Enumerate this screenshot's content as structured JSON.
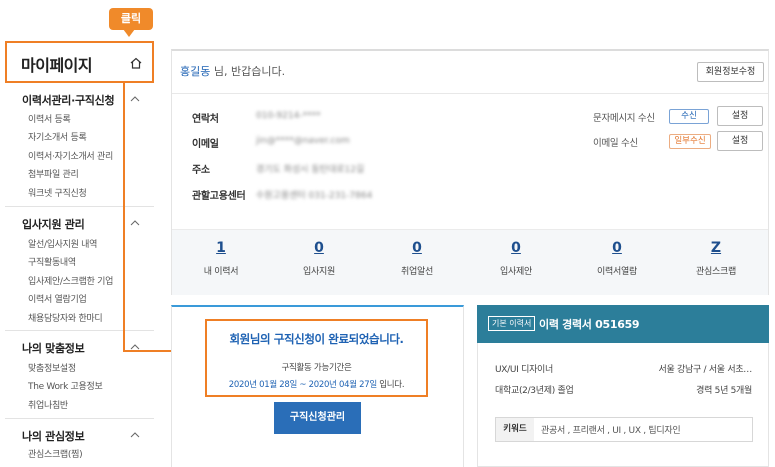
{
  "callout": {
    "label": "클릭"
  },
  "sidebar": {
    "title": "마이페이지",
    "sections": [
      {
        "title": "이력서관리·구직신청",
        "items": [
          "이력서 등록",
          "자기소개서 등록",
          "이력서·자기소개서 관리",
          "첨부파일 관리",
          "워크넷 구직신청"
        ]
      },
      {
        "title": "입사지원 관리",
        "items": [
          "알선/입사지원 내역",
          "구직활동내역",
          "입사제안/스크랩한 기업",
          "이력서 열람기업",
          "채용담당자와 한마디"
        ]
      },
      {
        "title": "나의 맞춤정보",
        "items": [
          "맞춤정보설정",
          "The Work 고용정보",
          "취업나침반"
        ]
      },
      {
        "title": "나의 관심정보",
        "items": [
          "관심스크랩(찜)"
        ]
      }
    ]
  },
  "profile": {
    "greeting_name": "홍길동",
    "greeting_suffix": " 님, 반갑습니다.",
    "edit_button": "회원정보수정",
    "fields": {
      "phone_label": "연락처",
      "phone_value": "010-9214-****",
      "email_label": "이메일",
      "email_value": "jin@****@naver.com",
      "address_label": "주소",
      "address_value": "경기도 화성시 동탄대로12길",
      "center_label": "관할고용센터",
      "center_value": "수원고용센터 031-231-7864"
    },
    "sms": {
      "label": "문자메시지 수신",
      "status": "수신",
      "button": "설정"
    },
    "email_receive": {
      "label": "이메일 수신",
      "status": "일부수신",
      "button": "설정"
    },
    "stats": [
      {
        "value": "1",
        "label": "내 이력서"
      },
      {
        "value": "0",
        "label": "입사지원"
      },
      {
        "value": "0",
        "label": "취업알선"
      },
      {
        "value": "0",
        "label": "입사제안"
      },
      {
        "value": "0",
        "label": "이력서열람"
      },
      {
        "value": "Z",
        "label": "관심스크랩"
      }
    ]
  },
  "application": {
    "message": "회원님의 구직신청이 완료되었습니다.",
    "period_label": "구직활동 가능기간은",
    "period_dates": "2020년 01월 28일 ~ 2020년 04월 27일",
    "period_suffix": " 입니다.",
    "manage_button": "구직신청관리"
  },
  "resume": {
    "tag": "기본 이력서",
    "title": "이력 경력서 051659",
    "job": "UX/UI 디자이너",
    "location": "서울 강남구 / 서울 서초…",
    "education": "대학교(2/3년제) 졸업",
    "career": "경력 5년 5개월",
    "keyword_label": "키워드",
    "keywords": "관공서 , 프리랜서 , UI , UX , 팁디자인"
  },
  "colors": {
    "accent_orange": "#ef7f25",
    "primary_blue": "#1e62b3",
    "resume_header": "#2c7e9a"
  }
}
